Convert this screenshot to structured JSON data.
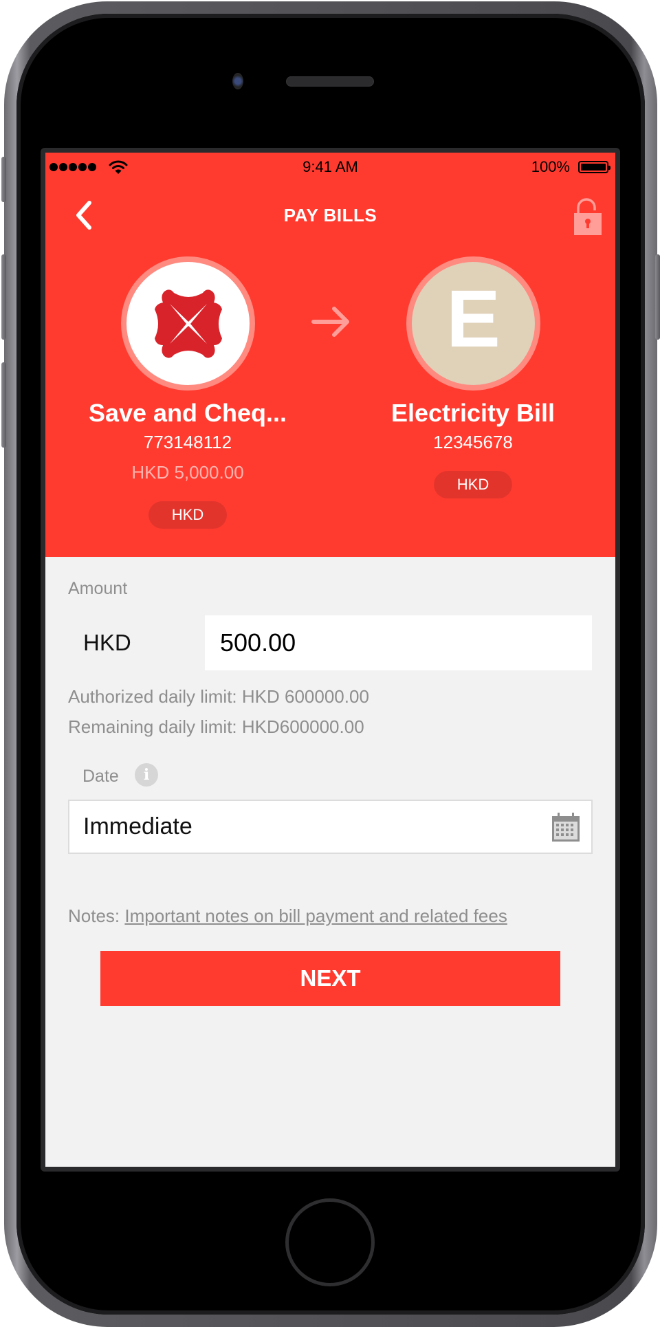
{
  "status_bar": {
    "time": "9:41 AM",
    "battery": "100%",
    "signal_icon": "signal-dots-icon",
    "wifi_icon": "wifi-icon",
    "battery_icon": "battery-full-icon"
  },
  "header": {
    "title": "PAY BILLS",
    "back_icon": "chevron-left-icon",
    "lock_icon": "unlocked-padlock-icon",
    "accent_color": "#ff3b30"
  },
  "transfer": {
    "from": {
      "icon": "dbs-logo-icon",
      "name": "Save and Cheq...",
      "account_number": "773148112",
      "balance": "HKD 5,000.00",
      "currency": "HKD"
    },
    "arrow_icon": "arrow-right-icon",
    "to": {
      "avatar_letter": "E",
      "avatar_color": "#e0d1b9",
      "name": "Electricity Bill",
      "account_number": "12345678",
      "currency": "HKD"
    }
  },
  "form": {
    "amount_label": "Amount",
    "currency": "HKD",
    "amount_value": "500.00",
    "authorized_limit": "Authorized daily limit: HKD 600000.00",
    "remaining_limit": "Remaining daily limit: HKD600000.00",
    "date_label": "Date",
    "info_icon": "info-icon",
    "date_value": "Immediate",
    "calendar_icon": "calendar-icon",
    "notes_prefix": "Notes: ",
    "notes_link": "Important notes on bill payment and related fees",
    "next_label": "NEXT"
  }
}
